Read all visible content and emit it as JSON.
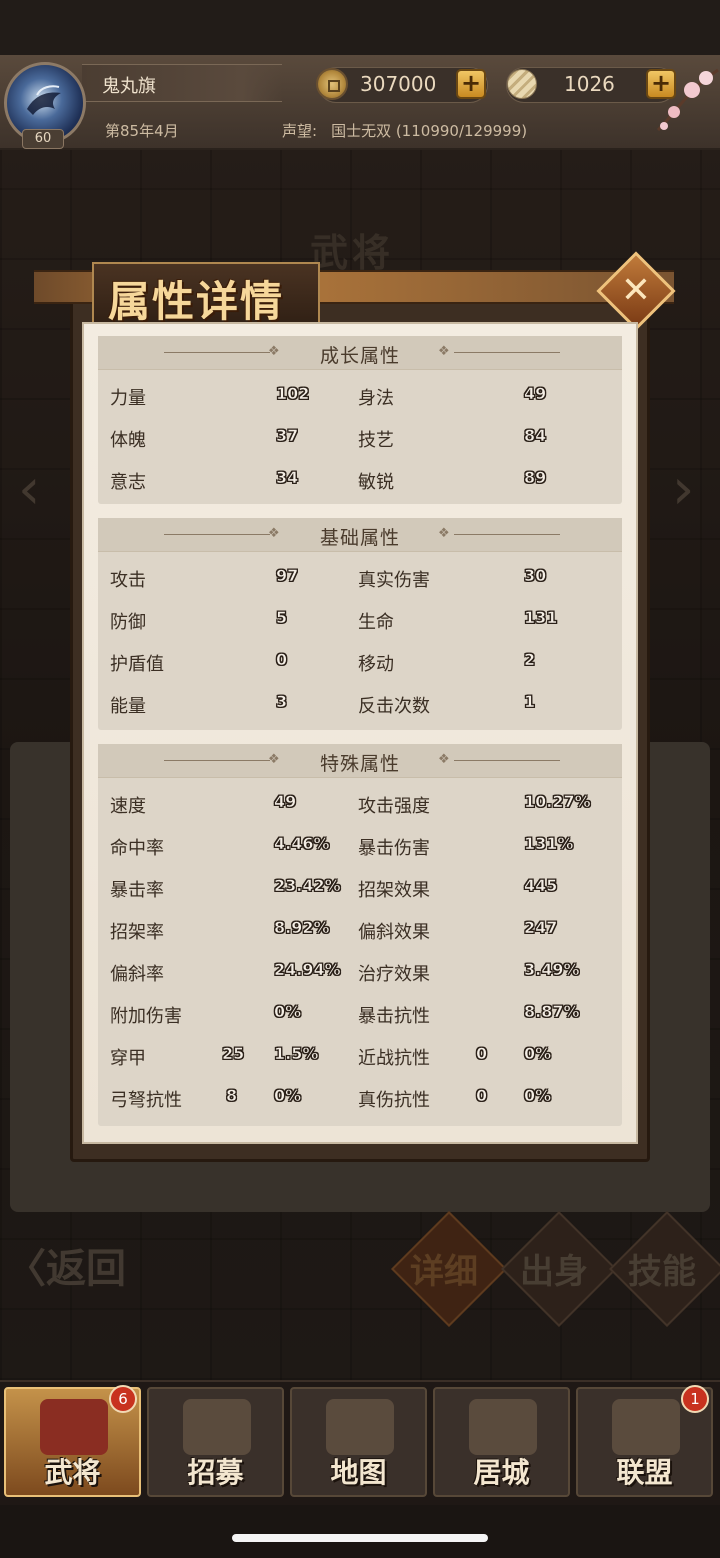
{
  "header": {
    "player_name": "鬼丸旗",
    "level": "60",
    "season": "第85年4月",
    "fame_label": "声望:",
    "fame_value": "国士无双 (110990/129999)",
    "gold": "307000",
    "scrolls": "1026",
    "plus_symbol": "+"
  },
  "background": {
    "title": "武将",
    "back_label": "〈返回",
    "tabs": [
      "详细",
      "出身",
      "技能"
    ]
  },
  "modal": {
    "title": "属性详情",
    "close_symbol": "✕",
    "growth": {
      "title": "成长属性",
      "rows": [
        {
          "l1": "力量",
          "v1": "102",
          "l2": "身法",
          "v2": "49"
        },
        {
          "l1": "体魄",
          "v1": "37",
          "l2": "技艺",
          "v2": "84"
        },
        {
          "l1": "意志",
          "v1": "34",
          "l2": "敏锐",
          "v2": "89"
        }
      ]
    },
    "basic": {
      "title": "基础属性",
      "rows": [
        {
          "l1": "攻击",
          "v1": "97",
          "l2": "真实伤害",
          "v2": "30"
        },
        {
          "l1": "防御",
          "v1": "5",
          "l2": "生命",
          "v2": "131"
        },
        {
          "l1": "护盾值",
          "v1": "0",
          "l2": "移动",
          "v2": "2"
        },
        {
          "l1": "能量",
          "v1": "3",
          "l2": "反击次数",
          "v2": "1"
        }
      ]
    },
    "special": {
      "title": "特殊属性",
      "rows": [
        {
          "l1": "速度",
          "v1": "49",
          "l2": "攻击强度",
          "v2": "10.27%"
        },
        {
          "l1": "命中率",
          "v1": "4.46%",
          "l2": "暴击伤害",
          "v2": "131%"
        },
        {
          "l1": "暴击率",
          "v1": "23.42%",
          "l2": "招架效果",
          "v2": "445"
        },
        {
          "l1": "招架率",
          "v1": "8.92%",
          "l2": "偏斜效果",
          "v2": "247"
        },
        {
          "l1": "偏斜率",
          "v1": "24.94%",
          "l2": "治疗效果",
          "v2": "3.49%"
        },
        {
          "l1": "附加伤害",
          "v1": "0%",
          "l2": "暴击抗性",
          "v2": "8.87%"
        }
      ],
      "rows4": [
        {
          "l1": "穿甲",
          "n1": "25",
          "v1": "1.5%",
          "l2": "近战抗性",
          "n2": "0",
          "v2": "0%"
        },
        {
          "l1": "弓弩抗性",
          "n1": "8",
          "v1": "0%",
          "l2": "真伤抗性",
          "n2": "0",
          "v2": "0%"
        }
      ]
    }
  },
  "nav": [
    {
      "label": "武将",
      "badge": "6",
      "icon": "samurai-helmet-icon"
    },
    {
      "label": "招募",
      "badge": "",
      "icon": "katana-icon"
    },
    {
      "label": "地图",
      "badge": "",
      "icon": "map-scroll-icon"
    },
    {
      "label": "居城",
      "badge": "",
      "icon": "castle-icon"
    },
    {
      "label": "联盟",
      "badge": "1",
      "icon": "banner-icon"
    }
  ]
}
